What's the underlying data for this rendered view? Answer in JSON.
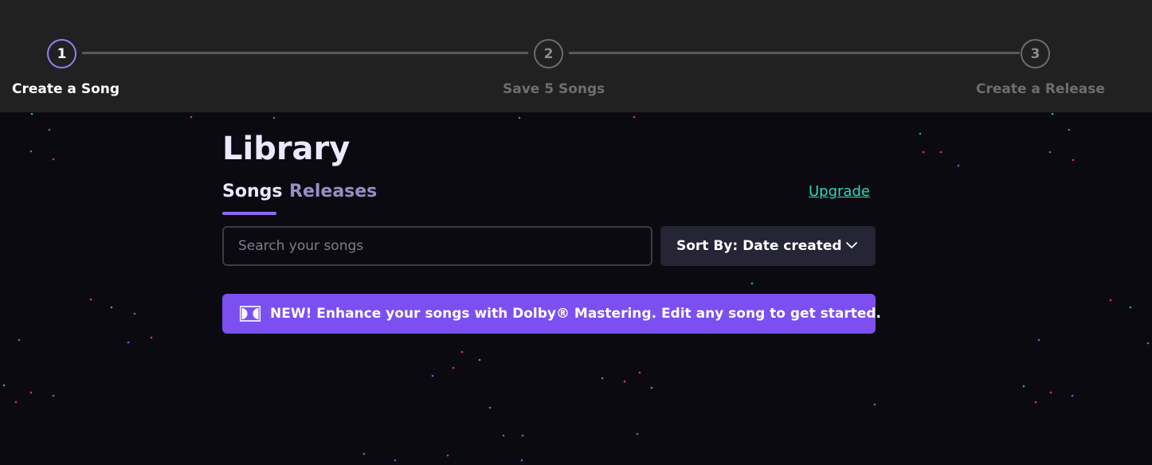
{
  "stepper": {
    "steps": [
      {
        "number": "1",
        "label": "Create a Song",
        "active": true
      },
      {
        "number": "2",
        "label": "Save 5 Songs",
        "active": false
      },
      {
        "number": "3",
        "label": "Create a Release",
        "active": false
      }
    ]
  },
  "library": {
    "title": "Library",
    "tabs": [
      {
        "label": "Songs",
        "active": true
      },
      {
        "label": "Releases",
        "active": false
      }
    ],
    "upgrade_label": "Upgrade"
  },
  "search": {
    "placeholder": "Search your songs",
    "value": ""
  },
  "sort": {
    "label": "Sort By: Date created"
  },
  "banner": {
    "icon": "dolby-icon",
    "text": "NEW! Enhance your songs with Dolby® Mastering. Edit any song to get started."
  },
  "colors": {
    "accent": "#8c6cf2",
    "banner": "#7c4ff0",
    "upgrade": "#2fd6c0",
    "background": "#0b0a10",
    "stepper_bg": "#212121"
  }
}
